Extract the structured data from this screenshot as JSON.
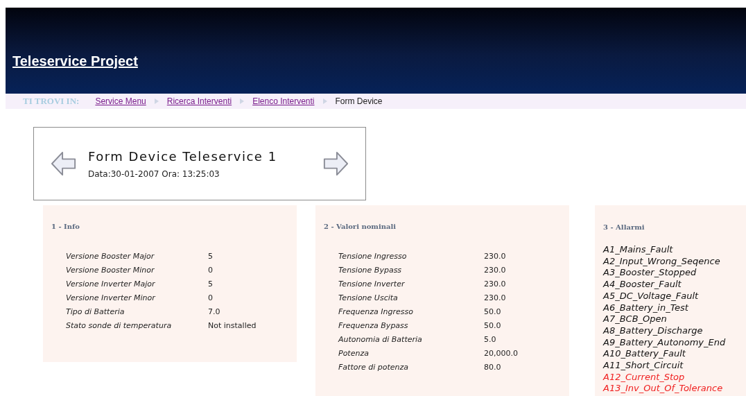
{
  "header": {
    "title": "Teleservice Project"
  },
  "breadcrumb": {
    "label": "TI TROVI IN:",
    "items": [
      {
        "text": "Service Menu",
        "kind": "link"
      },
      {
        "text": "Ricerca Interventi",
        "kind": "link"
      },
      {
        "text": "Elenco Interventi",
        "kind": "link"
      },
      {
        "text": "Form Device",
        "kind": "current"
      }
    ]
  },
  "device": {
    "title": "Form Device Teleservice 1",
    "subtitle": "Data:30-01-2007 Ora: 13:25:03"
  },
  "info": {
    "title": "1 - Info",
    "rows": [
      {
        "label": "Versione Booster Major",
        "value": "5"
      },
      {
        "label": "Versione Booster Minor",
        "value": "0"
      },
      {
        "label": "Versione Inverter Major",
        "value": "5"
      },
      {
        "label": "Versione Inverter Minor",
        "value": "0"
      },
      {
        "label": "Tipo di Batteria",
        "value": "7.0"
      },
      {
        "label": "Stato sonde di temperatura",
        "value": "Not installed"
      }
    ]
  },
  "nominal": {
    "title": "2 - Valori nominali",
    "rows": [
      {
        "label": "Tensione Ingresso",
        "value": "230.0"
      },
      {
        "label": "Tensione Bypass",
        "value": "230.0"
      },
      {
        "label": "Tensione Inverter",
        "value": "230.0"
      },
      {
        "label": "Tensione Uscita",
        "value": "230.0"
      },
      {
        "label": "Frequenza Ingresso",
        "value": "50.0"
      },
      {
        "label": "Frequenza Bypass",
        "value": "50.0"
      },
      {
        "label": "Autonomia di Batteria",
        "value": "5.0"
      },
      {
        "label": "Potenza",
        "value": "20,000.0"
      },
      {
        "label": "Fattore di potenza",
        "value": "80.0"
      }
    ]
  },
  "alarms": {
    "title": "3 - Allarmi",
    "items": [
      {
        "text": "A1_Mains_Fault",
        "active": false
      },
      {
        "text": "A2_Input_Wrong_Seqence",
        "active": false
      },
      {
        "text": "A3_Booster_Stopped",
        "active": false
      },
      {
        "text": "A4_Booster_Fault",
        "active": false
      },
      {
        "text": "A5_DC_Voltage_Fault",
        "active": false
      },
      {
        "text": "A6_Battery_in_Test",
        "active": false
      },
      {
        "text": "A7_BCB_Open",
        "active": false
      },
      {
        "text": "A8_Battery_Discharge",
        "active": false
      },
      {
        "text": "A9_Battery_Autonomy_End",
        "active": false
      },
      {
        "text": "A10_Battery_Fault",
        "active": false
      },
      {
        "text": "A11_Short_Circuit",
        "active": false
      },
      {
        "text": "A12_Current_Stop",
        "active": true
      },
      {
        "text": "A13_Inv_Out_Of_Tolerance",
        "active": true
      }
    ]
  }
}
